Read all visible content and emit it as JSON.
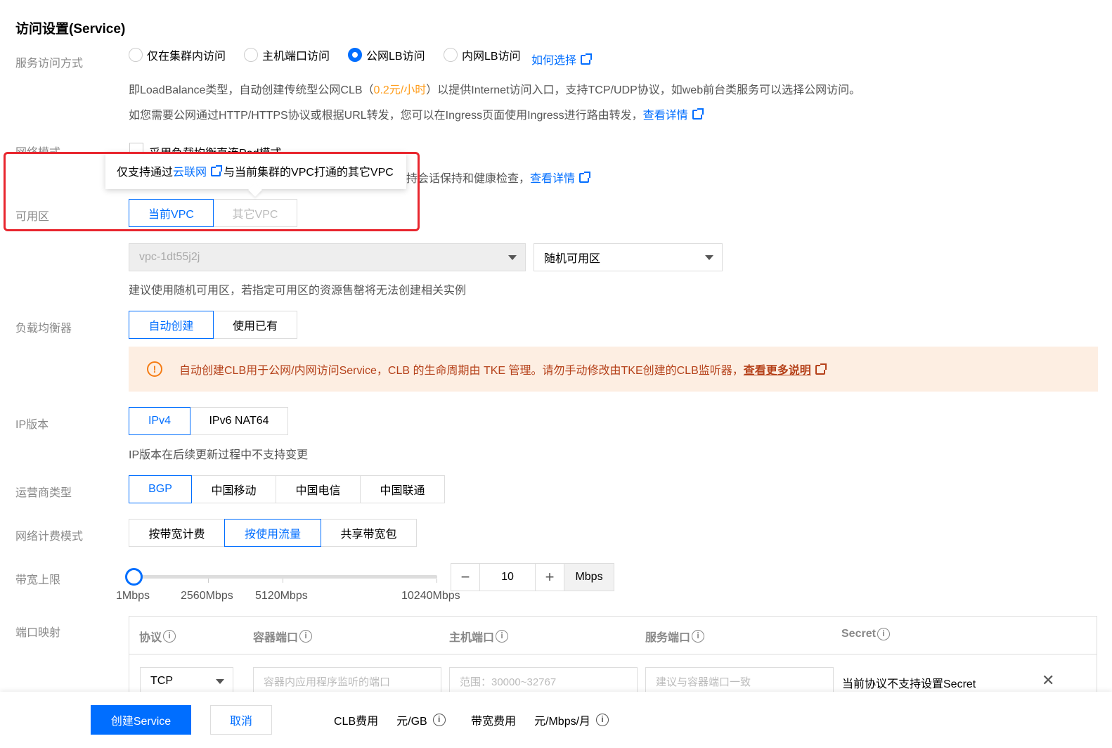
{
  "section_title": "访问设置(Service)",
  "access": {
    "label": "服务访问方式",
    "options": [
      "仅在集群内访问",
      "主机端口访问",
      "公网LB访问",
      "内网LB访问"
    ],
    "selected_index": 2,
    "help_link": "如何选择",
    "desc1_pre": "即LoadBalance类型，自动创建传统型公网CLB（",
    "desc1_price": "0.2元/小时",
    "desc1_post": "）以提供Internet访问入口，支持TCP/UDP协议，如web前台类服务可以选择公网访问。",
    "desc2": "如您需要公网通过HTTP/HTTPS协议或根据URL转发，您可以在Ingress页面使用Ingress进行路由转发，",
    "desc2_link": "查看详情"
  },
  "network_mode": {
    "label": "网络模式",
    "checkbox_text": "采用负载均衡直连Pod模式",
    "desc_tail": "持会话保持和健康检查，",
    "desc_link": "查看详情"
  },
  "tooltip": {
    "pre": "仅支持通过",
    "link": "云联网",
    "post": "与当前集群的VPC打通的其它VPC"
  },
  "zone": {
    "label": "可用区",
    "options": [
      "当前VPC",
      "其它VPC"
    ],
    "vpc_value": "vpc-1dt55j2j",
    "zone_value": "随机可用区",
    "hint": "建议使用随机可用区，若指定可用区的资源售罄将无法创建相关实例"
  },
  "lb": {
    "label": "负载均衡器",
    "options": [
      "自动创建",
      "使用已有"
    ],
    "notice": "自动创建CLB用于公网/内网访问Service，CLB 的生命周期由 TKE 管理。请勿手动修改由TKE创建的CLB监听器，",
    "notice_link": "查看更多说明",
    "warn_glyph": "!"
  },
  "ip_version": {
    "label": "IP版本",
    "options": [
      "IPv4",
      "IPv6 NAT64"
    ],
    "hint": "IP版本在后续更新过程中不支持变更"
  },
  "isp": {
    "label": "运营商类型",
    "options": [
      "BGP",
      "中国移动",
      "中国电信",
      "中国联通"
    ]
  },
  "billing": {
    "label": "网络计费模式",
    "options": [
      "按带宽计费",
      "按使用流量",
      "共享带宽包"
    ]
  },
  "bandwidth": {
    "label": "带宽上限",
    "ticks": [
      "1Mbps",
      "2560Mbps",
      "5120Mbps",
      "10240Mbps"
    ],
    "value": "10",
    "unit": "Mbps",
    "level_fraction": 0.0,
    "minus": "−",
    "plus": "+"
  },
  "port_mapping": {
    "label": "端口映射",
    "headers": [
      "协议",
      "容器端口",
      "主机端口",
      "服务端口",
      "Secret"
    ],
    "info_glyph": "i",
    "protocol_value": "TCP",
    "container_port_placeholder": "容器内应用程序监听的端口",
    "host_port_placeholder": "范围：30000~32767",
    "service_port_placeholder": "建议与容器端口一致",
    "secret_text": "当前协议不支持设置Secret",
    "remove_glyph": "✕"
  },
  "footer": {
    "create": "创建Service",
    "cancel": "取消",
    "clb_fee_label": "CLB费用",
    "clb_fee_value": "元/GB",
    "bw_fee_label": "带宽费用",
    "bw_fee_value": "元/Mbps/月"
  },
  "colors": {
    "primary": "#006eff",
    "price": "#ff9c19",
    "warning": "#b5411a",
    "highlight": "#e8262e"
  }
}
